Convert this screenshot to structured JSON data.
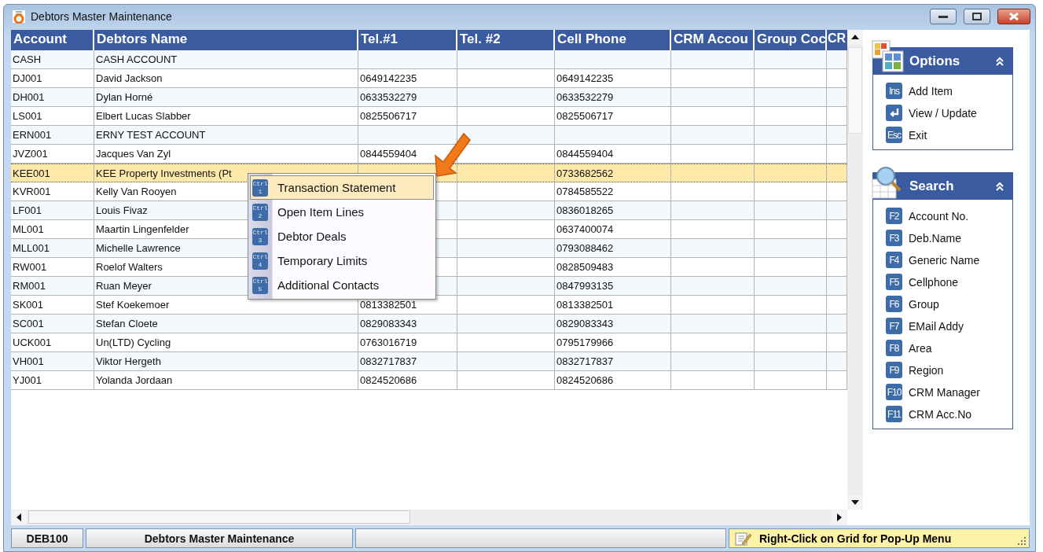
{
  "window": {
    "title": "Debtors Master Maintenance"
  },
  "table": {
    "columns": [
      "Account",
      "Debtors Name",
      "Tel.#1",
      "Tel. #2",
      "Cell Phone",
      "CRM Accou",
      "Group Coc",
      "CR"
    ],
    "rows": [
      {
        "account": "CASH",
        "name": "CASH ACCOUNT",
        "selected": false
      },
      {
        "account": "DJ001",
        "name": "David Jackson",
        "tel1": "0649142235",
        "cell": "0649142235",
        "selected": false
      },
      {
        "account": "DH001",
        "name": "Dylan Horné",
        "tel1": "0633532279",
        "cell": "0633532279",
        "selected": false
      },
      {
        "account": "LS001",
        "name": "Elbert Lucas Slabber",
        "tel1": "0825506717",
        "cell": "0825506717",
        "selected": false
      },
      {
        "account": "ERN001",
        "name": "ERNY TEST ACCOUNT",
        "selected": false
      },
      {
        "account": "JVZ001",
        "name": "Jacques Van Zyl",
        "tel1": "0844559404",
        "cell": "0844559404",
        "selected": false
      },
      {
        "account": "KEE001",
        "name": "KEE Property Investments (Pt",
        "cell": "0733682562",
        "selected": true
      },
      {
        "account": "KVR001",
        "name": "Kelly Van Rooyen",
        "cell": "0784585522",
        "selected": false
      },
      {
        "account": "LF001",
        "name": "Louis Fivaz",
        "cell": "0836018265",
        "selected": false
      },
      {
        "account": "ML001",
        "name": "Maartin Lingenfelder",
        "cell": "0637400074",
        "selected": false
      },
      {
        "account": "MLL001",
        "name": "Michelle Lawrence",
        "cell": "0793088462",
        "selected": false
      },
      {
        "account": "RW001",
        "name": "Roelof Walters",
        "cell": "0828509483",
        "selected": false
      },
      {
        "account": "RM001",
        "name": "Ruan Meyer",
        "cell": "0847993135",
        "selected": false
      },
      {
        "account": "SK001",
        "name": "Stef Koekemoer",
        "tel1": "0813382501",
        "cell": "0813382501",
        "selected": false
      },
      {
        "account": "SC001",
        "name": "Stefan Cloete",
        "tel1": "0829083343",
        "cell": "0829083343",
        "selected": false
      },
      {
        "account": "UCK001",
        "name": "Un(LTD) Cycling",
        "tel1": "0763016719",
        "cell": "0795179966",
        "selected": false
      },
      {
        "account": "VH001",
        "name": "Viktor Hergeth",
        "tel1": "0832717837",
        "cell": "0832717837",
        "selected": false
      },
      {
        "account": "YJ001",
        "name": "Yolanda Jordaan",
        "tel1": "0824520686",
        "cell": "0824520686",
        "selected": false
      }
    ]
  },
  "context_menu": {
    "items": [
      {
        "key_lines": [
          "Ctrl",
          "1"
        ],
        "label": "Transaction Statement",
        "selected": true
      },
      {
        "key_lines": [
          "Ctrl",
          "2"
        ],
        "label": "Open Item Lines",
        "selected": false
      },
      {
        "key_lines": [
          "Ctrl",
          "3"
        ],
        "label": "Debtor Deals",
        "selected": false
      },
      {
        "key_lines": [
          "Ctrl",
          "4"
        ],
        "label": "Temporary Limits",
        "selected": false
      },
      {
        "key_lines": [
          "Ctrl",
          "5"
        ],
        "label": "Additional Contacts",
        "selected": false
      }
    ]
  },
  "options_panel": {
    "title": "Options",
    "items": [
      {
        "kind": "key",
        "key": "Ins",
        "label": "Add Item"
      },
      {
        "kind": "enter",
        "label": "View / Update"
      },
      {
        "kind": "key",
        "key": "Esc",
        "label": "Exit"
      }
    ]
  },
  "search_panel": {
    "title": "Search",
    "items": [
      {
        "kind": "key",
        "key": "F2",
        "label": "Account No."
      },
      {
        "kind": "key",
        "key": "F3",
        "label": "Deb.Name"
      },
      {
        "kind": "key",
        "key": "F4",
        "label": "Generic Name"
      },
      {
        "kind": "key",
        "key": "F5",
        "label": "Cellphone"
      },
      {
        "kind": "key",
        "key": "F6",
        "label": "Group"
      },
      {
        "kind": "key",
        "key": "F7",
        "label": "EMail Addy"
      },
      {
        "kind": "key",
        "key": "F8",
        "label": "Area"
      },
      {
        "kind": "key",
        "key": "F9",
        "label": "Region"
      },
      {
        "kind": "key",
        "key": "F10",
        "label": "CRM Manager"
      },
      {
        "kind": "key",
        "key": "F11",
        "label": "CRM Acc.No"
      }
    ]
  },
  "status_bar": {
    "code": "DEB100",
    "screen": "Debtors Master Maintenance",
    "hint": "Right-Click on Grid for Pop-Up Menu"
  }
}
